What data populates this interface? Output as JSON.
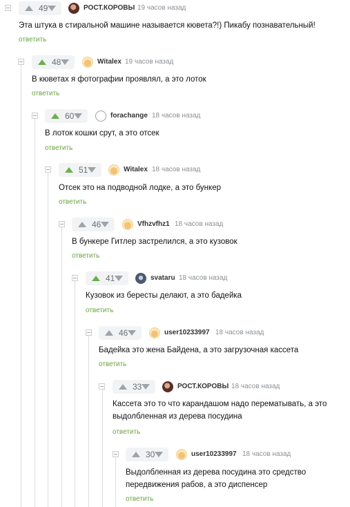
{
  "reply_label": "ответить",
  "colors": {
    "up_active": "#6ab04c",
    "up_inactive": "#9ea3a8",
    "reply": "#6aa341"
  },
  "comments": [
    {
      "rating": "49",
      "vote": "none",
      "avatar_icon": "user-photo-icon",
      "user": "РОСТ.КОРОВЫ",
      "time": "19 часов назад",
      "text": "Эта штука в стиральной машине называется кювета?!) Пикабу познавательный!"
    },
    {
      "rating": "48",
      "vote": "up",
      "avatar_icon": "default-avatar-icon",
      "user": "Witalex",
      "time": "19 часов назад",
      "text": "В кюветах я фотографии проявлял, а это лоток"
    },
    {
      "rating": "60",
      "vote": "up",
      "avatar_icon": "empty-avatar-icon",
      "user": "forachange",
      "time": "18 часов назад",
      "text": "В лоток кошки срут, а это отсек"
    },
    {
      "rating": "51",
      "vote": "up",
      "avatar_icon": "default-avatar-icon",
      "user": "Witalex",
      "time": "18 часов назад",
      "text": "Отсек это на подводной лодке, а это бункер"
    },
    {
      "rating": "46",
      "vote": "none",
      "avatar_icon": "default-avatar-icon",
      "user": "Vfhzvfhz1",
      "time": "18 часов назад",
      "text": "В бункере Гитлер застрелился, а это кузовок"
    },
    {
      "rating": "41",
      "vote": "up",
      "avatar_icon": "user-photo-icon",
      "user": "svataru",
      "time": "18 часов назад",
      "text": "Кузовок из бересты делают, а это бадейка"
    },
    {
      "rating": "46",
      "vote": "none",
      "avatar_icon": "default-avatar-icon",
      "user": "user10233997",
      "time": "18 часов назад",
      "text": "Бадейка это жена Байдена, а это загрузочная кассета"
    },
    {
      "rating": "33",
      "vote": "none",
      "avatar_icon": "user-photo-icon",
      "user": "РОСТ.КОРОВЫ",
      "time": "18 часов назад",
      "text_lines": [
        "Кассета это то что карандашом надо перематывать, а это",
        "выдолбленная из дерева посудина"
      ]
    },
    {
      "rating": "30",
      "vote": "none",
      "avatar_icon": "default-avatar-icon",
      "user": "user10233997",
      "time": "18 часов назад",
      "text_lines": [
        "Выдолбленная из дерева посудина это средство",
        "передвижения рабов, а это диспенсер"
      ]
    }
  ]
}
